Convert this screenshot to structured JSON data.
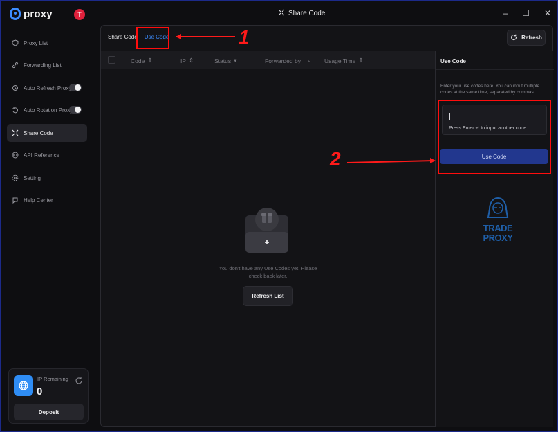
{
  "app": {
    "logo_text": "proxy",
    "avatar_initial": "T",
    "window_title": "Share Code"
  },
  "sidebar": {
    "items": [
      {
        "label": "Proxy List",
        "icon": "shield-icon"
      },
      {
        "label": "Forwarding List",
        "icon": "link-icon"
      },
      {
        "label": "Auto Refresh Proxy",
        "icon": "refresh-shield-icon",
        "toggle": true
      },
      {
        "label": "Auto Rotation Proxy",
        "icon": "rotation-icon",
        "toggle": true
      },
      {
        "label": "Share Code",
        "icon": "share-icon",
        "active": true
      },
      {
        "label": "API Reference",
        "icon": "api-icon"
      },
      {
        "label": "Setting",
        "icon": "gear-icon"
      },
      {
        "label": "Help Center",
        "icon": "help-icon"
      }
    ],
    "ip_card": {
      "label": "IP Remaining",
      "value": "0",
      "deposit_label": "Deposit"
    }
  },
  "main": {
    "tabs": [
      {
        "label": "Share Code"
      },
      {
        "label": "Use Code",
        "active": true
      }
    ],
    "refresh_label": "Refresh",
    "table_headers": [
      "Code",
      "IP",
      "Status",
      "Forwarded by",
      "Usage Time"
    ],
    "empty_message": "You don't have any Use Codes yet. Please check back later.",
    "refresh_list_label": "Refresh List"
  },
  "panel": {
    "title": "Use Code",
    "description": "Enter your use codes here. You can input multiple codes at the same time, separated by commas.",
    "input_hint": "Press Enter ↵ to input another code.",
    "use_code_button": "Use Code",
    "watermark_line1": "TRADE",
    "watermark_line2": "PROXY"
  },
  "annotations": {
    "one": "1",
    "two": "2"
  },
  "colors": {
    "accent": "#3d8dff",
    "primary_button": "#22378e",
    "highlight": "#ff0d0d",
    "avatar": "#e0213c"
  }
}
